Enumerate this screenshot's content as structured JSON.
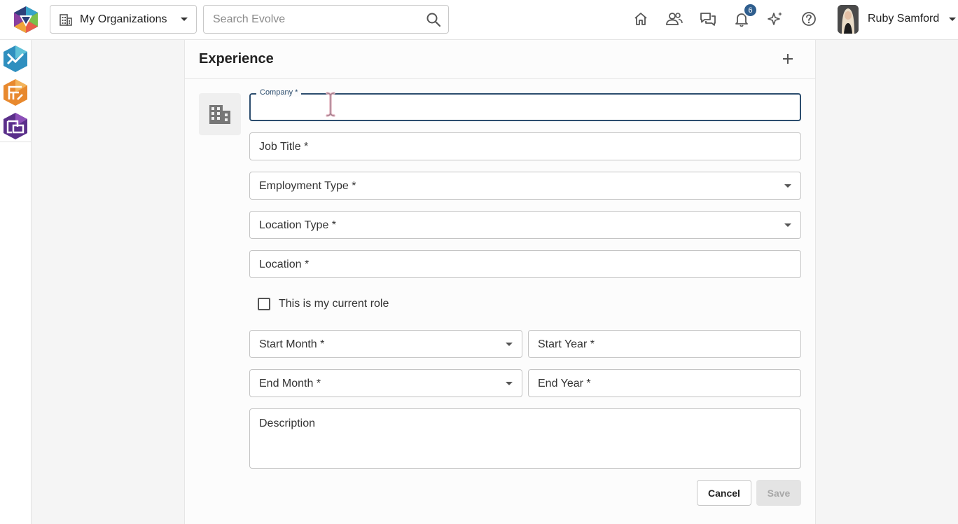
{
  "header": {
    "org_label": "My Organizations",
    "search_placeholder": "Search Evolve",
    "notification_count": "6",
    "user_name": "Ruby Samford"
  },
  "colors": {
    "accent": "#2c4d6e",
    "badge": "#2f5e8e",
    "rail_app_1": "#2f8fbf",
    "rail_app_2": "#e8892e",
    "rail_app_3": "#5a2f8a"
  },
  "icons": [
    "logo-icon",
    "building-icon",
    "search-icon",
    "home-icon",
    "people-icon",
    "chat-icon",
    "bell-icon",
    "sparkle-icon",
    "help-icon",
    "plus-icon"
  ],
  "card": {
    "title": "Experience"
  },
  "form": {
    "company_label": "Company *",
    "company_value": "",
    "job_title": "Job Title *",
    "employment_type": "Employment Type *",
    "location_type": "Location Type *",
    "location": "Location *",
    "current_role": "This is my current role",
    "start_month": "Start Month *",
    "start_year": "Start Year *",
    "end_month": "End Month *",
    "end_year": "End Year *",
    "description": "Description",
    "cancel": "Cancel",
    "save": "Save"
  }
}
